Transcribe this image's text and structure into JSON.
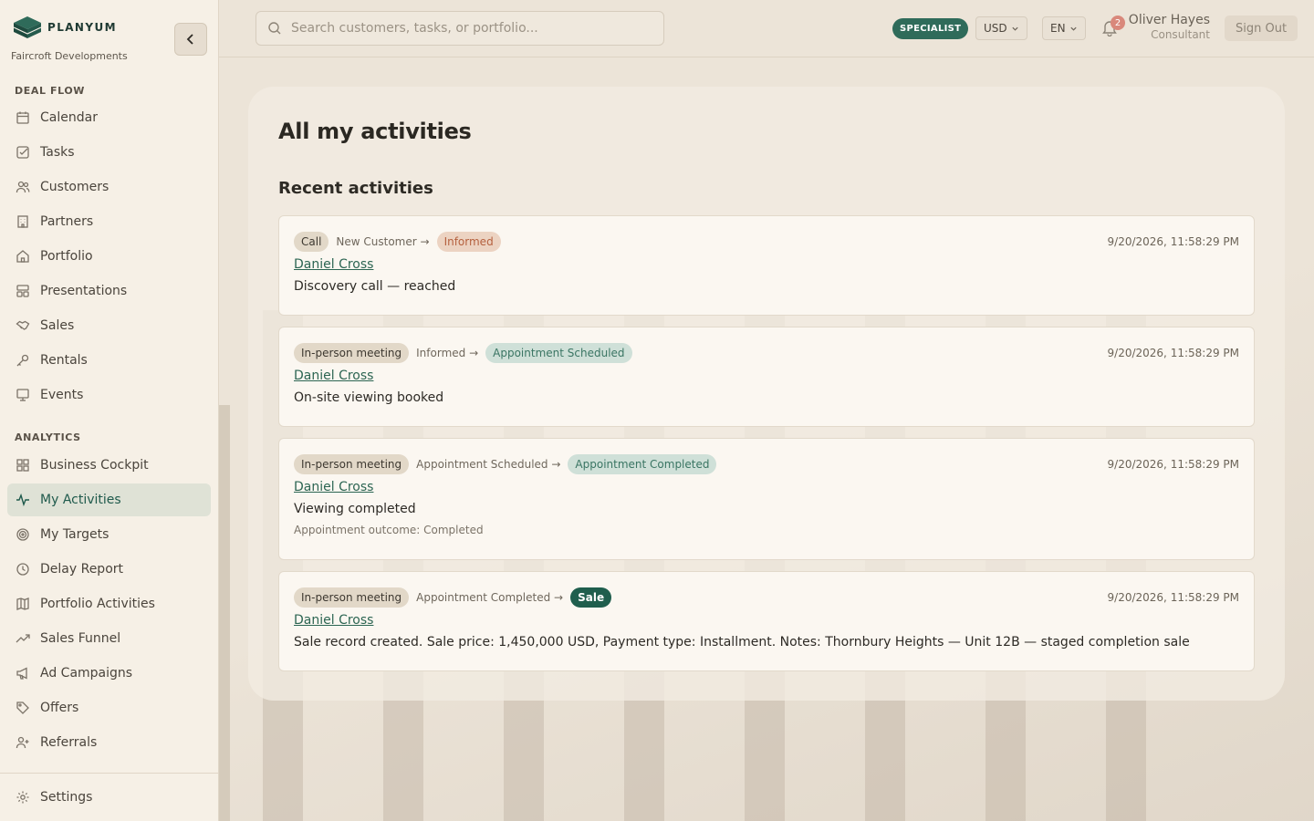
{
  "brand": {
    "name": "PLANYUM",
    "company": "Faircroft Developments"
  },
  "sidebar": {
    "deal_flow_title": "DEAL FLOW",
    "deal_flow": [
      {
        "label": "Calendar",
        "icon": "calendar-icon"
      },
      {
        "label": "Tasks",
        "icon": "task-check-icon"
      },
      {
        "label": "Customers",
        "icon": "users-icon"
      },
      {
        "label": "Partners",
        "icon": "building-icon"
      },
      {
        "label": "Portfolio",
        "icon": "home-icon"
      },
      {
        "label": "Presentations",
        "icon": "layout-icon"
      },
      {
        "label": "Sales",
        "icon": "handshake-icon"
      },
      {
        "label": "Rentals",
        "icon": "key-icon"
      },
      {
        "label": "Events",
        "icon": "presentation-icon"
      }
    ],
    "analytics_title": "ANALYTICS",
    "analytics": [
      {
        "label": "Business Cockpit",
        "icon": "grid-icon"
      },
      {
        "label": "My Activities",
        "icon": "activity-icon",
        "active": true
      },
      {
        "label": "My Targets",
        "icon": "target-icon"
      },
      {
        "label": "Delay Report",
        "icon": "clock-icon"
      },
      {
        "label": "Portfolio Activities",
        "icon": "map-icon"
      },
      {
        "label": "Sales Funnel",
        "icon": "trend-icon"
      },
      {
        "label": "Ad Campaigns",
        "icon": "megaphone-icon"
      },
      {
        "label": "Offers",
        "icon": "tag-icon"
      },
      {
        "label": "Referrals",
        "icon": "user-plus-icon"
      }
    ],
    "settings": {
      "label": "Settings",
      "icon": "gear-icon"
    }
  },
  "topbar": {
    "search_placeholder": "Search customers, tasks, or portfolio...",
    "role": "SPECIALIST",
    "currency": "USD",
    "language": "EN",
    "notification_count": "2",
    "user_name": "Oliver Hayes",
    "user_role": "Consultant",
    "sign_out": "Sign Out"
  },
  "page": {
    "title": "All my activities",
    "subtitle": "Recent activities"
  },
  "activities": [
    {
      "type": "Call",
      "from": "New Customer",
      "to": "Informed",
      "timestamp": "9/20/2026, 11:58:29 PM",
      "customer": "Daniel Cross",
      "description": "Discovery call — reached"
    },
    {
      "type": "In-person meeting",
      "from": "Informed",
      "to": "Appointment Scheduled",
      "timestamp": "9/20/2026, 11:58:29 PM",
      "customer": "Daniel Cross",
      "description": "On-site viewing booked"
    },
    {
      "type": "In-person meeting",
      "from": "Appointment Scheduled",
      "to": "Appointment Completed",
      "timestamp": "9/20/2026, 11:58:29 PM",
      "customer": "Daniel Cross",
      "description": "Viewing completed",
      "note": "Appointment outcome: Completed"
    },
    {
      "type": "In-person meeting",
      "from": "Appointment Completed",
      "to": "Sale",
      "timestamp": "9/20/2026, 11:58:29 PM",
      "customer": "Daniel Cross",
      "description": "Sale record created. Sale price: 1,450,000 USD, Payment type: Installment. Notes: Thornbury Heights — Unit 12B — staged completion sale"
    }
  ],
  "colors": {
    "accent": "#1f5e4d",
    "informed": "#b5613f",
    "stage_green": "#3a7563"
  }
}
